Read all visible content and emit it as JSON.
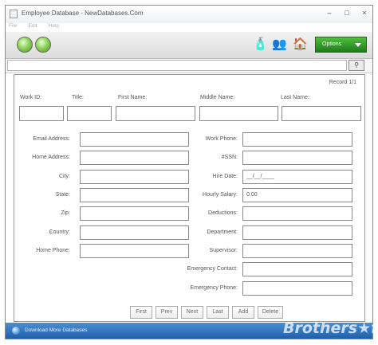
{
  "window": {
    "title": "Employee Database - NewDatabases.Com",
    "controls": {
      "minimize": "–",
      "maximize": "□",
      "close": "×"
    }
  },
  "menu": {
    "items": [
      "File",
      "Edit",
      "Help"
    ]
  },
  "toolbar": {
    "back_icon": "green-back-orb",
    "forward_icon": "green-forward-orb",
    "icons": [
      "soap-dispenser-icon",
      "people-icon",
      "home-icon"
    ],
    "options_label": "Options"
  },
  "urlbar": {
    "value": "",
    "go_icon": "magnifier-icon"
  },
  "form": {
    "record": "Record 1/1",
    "top_labels": {
      "work_id": "Work ID:",
      "title": "Title:",
      "first_name": "First Name:",
      "middle_name": "Middle Name:",
      "last_name": "Last Name:"
    },
    "left_labels": {
      "email": "Email Address:",
      "home_address": "Home Address:",
      "city": "City:",
      "state": "State:",
      "zip": "Zip:",
      "country": "Country:",
      "home_phone": "Home Phone:"
    },
    "right_labels": {
      "work_phone": "Work Phone:",
      "ssn": "#SSN:",
      "hire_date": "Hire Date:",
      "hourly_salary": "Hourly Salary:",
      "deductions": "Deductions:",
      "department": "Department:",
      "supervisor": "Supervisor:",
      "emergency_contact": "Emergency Contact:",
      "emergency_phone": "Emergency Phone:"
    },
    "values": {
      "hire_date": "__/__/____",
      "hourly_salary": "0.00"
    }
  },
  "nav_buttons": {
    "first": "First",
    "prev": "Prev",
    "next": "Next",
    "last": "Last",
    "add": "Add",
    "delete": "Delete"
  },
  "statusbar": {
    "text": "Download More Databases",
    "watermark": "Brothers★ft"
  }
}
